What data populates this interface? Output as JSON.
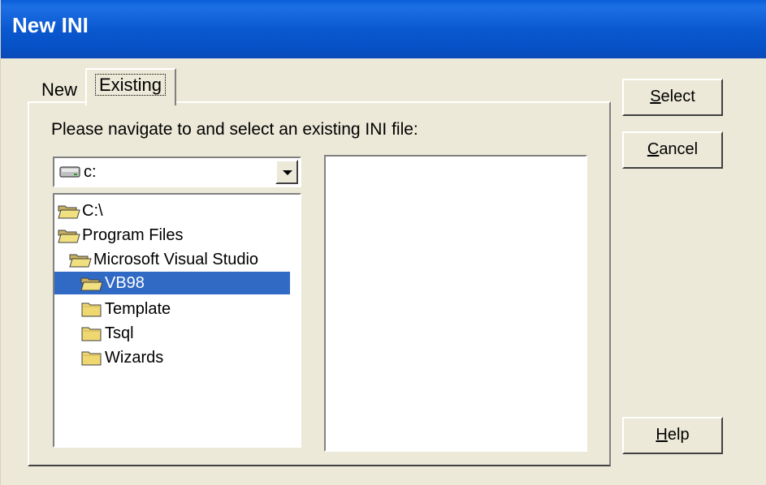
{
  "window": {
    "title": "New INI"
  },
  "tabs": [
    {
      "label": "New",
      "active": false
    },
    {
      "label": "Existing",
      "active": true
    }
  ],
  "panel": {
    "instruction": "Please navigate to and select an existing INI file:"
  },
  "drive_combo": {
    "value": "c:",
    "icon": "drive-icon"
  },
  "directories": [
    {
      "label": "C:\\",
      "icon": "open-folder-icon",
      "selected": false
    },
    {
      "label": "Program Files",
      "icon": "open-folder-icon",
      "selected": false
    },
    {
      "label": "Microsoft Visual Studio",
      "icon": "open-folder-icon",
      "selected": false
    },
    {
      "label": "VB98",
      "icon": "open-folder-icon",
      "selected": true
    },
    {
      "label": "Template",
      "icon": "closed-folder-icon",
      "selected": false
    },
    {
      "label": "Tsql",
      "icon": "closed-folder-icon",
      "selected": false
    },
    {
      "label": "Wizards",
      "icon": "closed-folder-icon",
      "selected": false
    }
  ],
  "files": [],
  "buttons": {
    "select": {
      "accel": "S",
      "rest": "elect"
    },
    "cancel": {
      "accel": "C",
      "rest": "ancel"
    },
    "help": {
      "accel": "H",
      "rest": "elp"
    }
  },
  "colors": {
    "title_bar": "#0a58d0",
    "face": "#ece9d8",
    "selection": "#316ac5"
  }
}
